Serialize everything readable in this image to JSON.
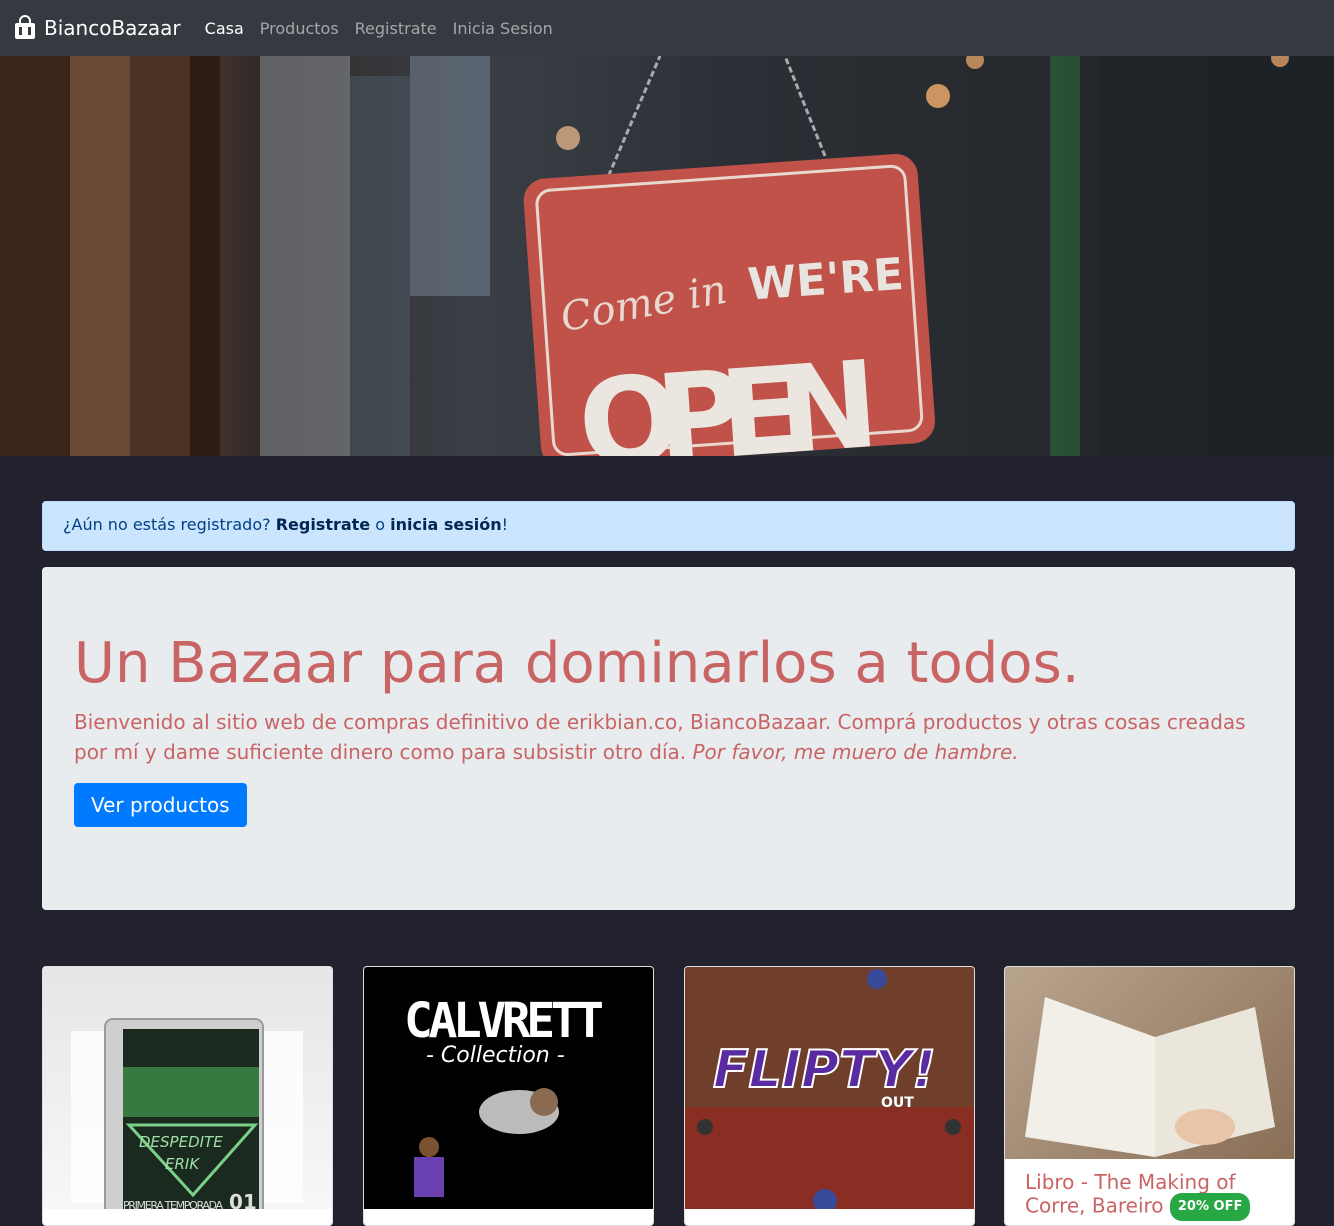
{
  "navbar": {
    "brand": "BiancoBazaar",
    "brand_icon": "shop-bag-icon",
    "links": [
      "Casa",
      "Productos",
      "Registrate",
      "Inicia Sesion"
    ]
  },
  "hero": {
    "sign_script": "Come in",
    "sign_top": "WE'RE",
    "sign_main": "OPEN"
  },
  "alert": {
    "prefix": "¿Aún no estás registrado? ",
    "register_link": "Registrate",
    "middle": " o ",
    "login_link": "inicia sesión",
    "suffix": "!"
  },
  "jumbotron": {
    "title": "Un Bazaar para dominarlos a todos.",
    "lead": "Bienvenido al sitio web de compras definitivo de erikbian.co, BiancoBazaar. Comprá productos y otras cosas creadas por mí y dame suficiente dinero como para subsistir otro día. ",
    "lead_italic": "Por favor, me muero de hambre.",
    "button": "Ver productos"
  },
  "products": [
    {
      "image_label_top": "DESPEDITE",
      "image_label_bottom": "ERIK",
      "image_label_season": "PRIMERA TEMPORADA",
      "image_label_number": "01"
    },
    {
      "image_label_top": "CALVRETT",
      "image_label_bottom": "- Collection -"
    },
    {
      "image_label_top": "FLIPTY!",
      "image_label_bottom": "OUT"
    },
    {
      "title_line1": "Libro - The Making of",
      "title_line2": "Corre, Bareiro",
      "badge": "20% OFF"
    }
  ],
  "colors": {
    "navbar": "#343a40",
    "page_bg": "#22222f",
    "alert_bg": "#cce5ff",
    "jumbotron_bg": "#e9ecef",
    "accent_red": "#c96464",
    "primary": "#007bff",
    "badge_green": "#28a745"
  }
}
